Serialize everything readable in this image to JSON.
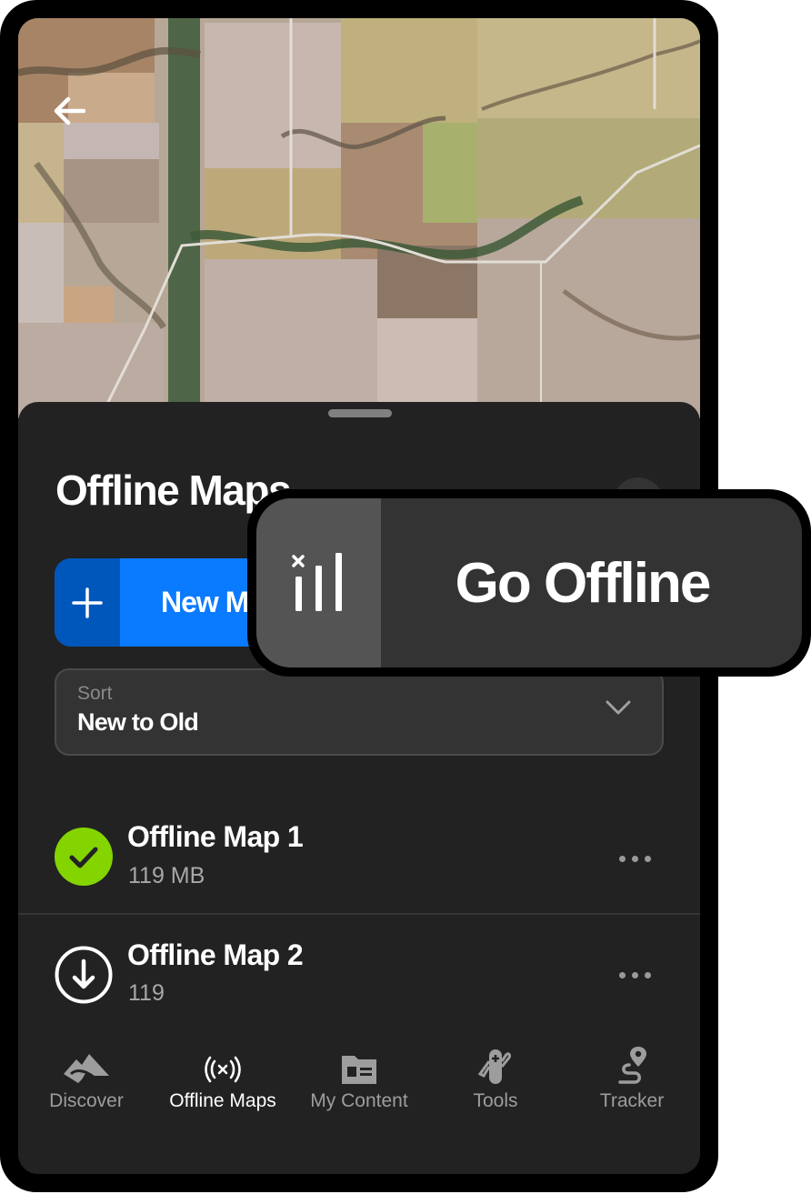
{
  "header": {
    "back_icon": "arrow-left-icon"
  },
  "sheet": {
    "title": "Offline Maps",
    "more_icon": "more-horizontal-icon",
    "new_map_button": {
      "label": "New Map",
      "icon": "plus-icon"
    },
    "sort": {
      "label": "Sort",
      "value": "New to Old",
      "icon": "chevron-down-icon"
    },
    "maps": [
      {
        "name": "Offline Map 1",
        "size": "119 MB",
        "status": "downloaded",
        "status_icon": "check-circle-icon"
      },
      {
        "name": "Offline Map 2",
        "size": "119",
        "status": "not-downloaded",
        "status_icon": "download-circle-icon"
      }
    ]
  },
  "bottom_nav": {
    "items": [
      {
        "label": "Discover",
        "icon": "mountain-route-icon",
        "active": false
      },
      {
        "label": "Offline Maps",
        "icon": "offline-signal-icon",
        "active": true
      },
      {
        "label": "My Content",
        "icon": "folder-card-icon",
        "active": false
      },
      {
        "label": "Tools",
        "icon": "multitool-icon",
        "active": false
      },
      {
        "label": "Tracker",
        "icon": "location-path-icon",
        "active": false
      }
    ]
  },
  "callout": {
    "label": "Go Offline",
    "icon": "no-signal-icon"
  },
  "colors": {
    "accent_blue": "#0a7aff",
    "accent_blue_dark": "#0057bb",
    "success_green": "#84d400",
    "sheet_bg": "#222222"
  }
}
